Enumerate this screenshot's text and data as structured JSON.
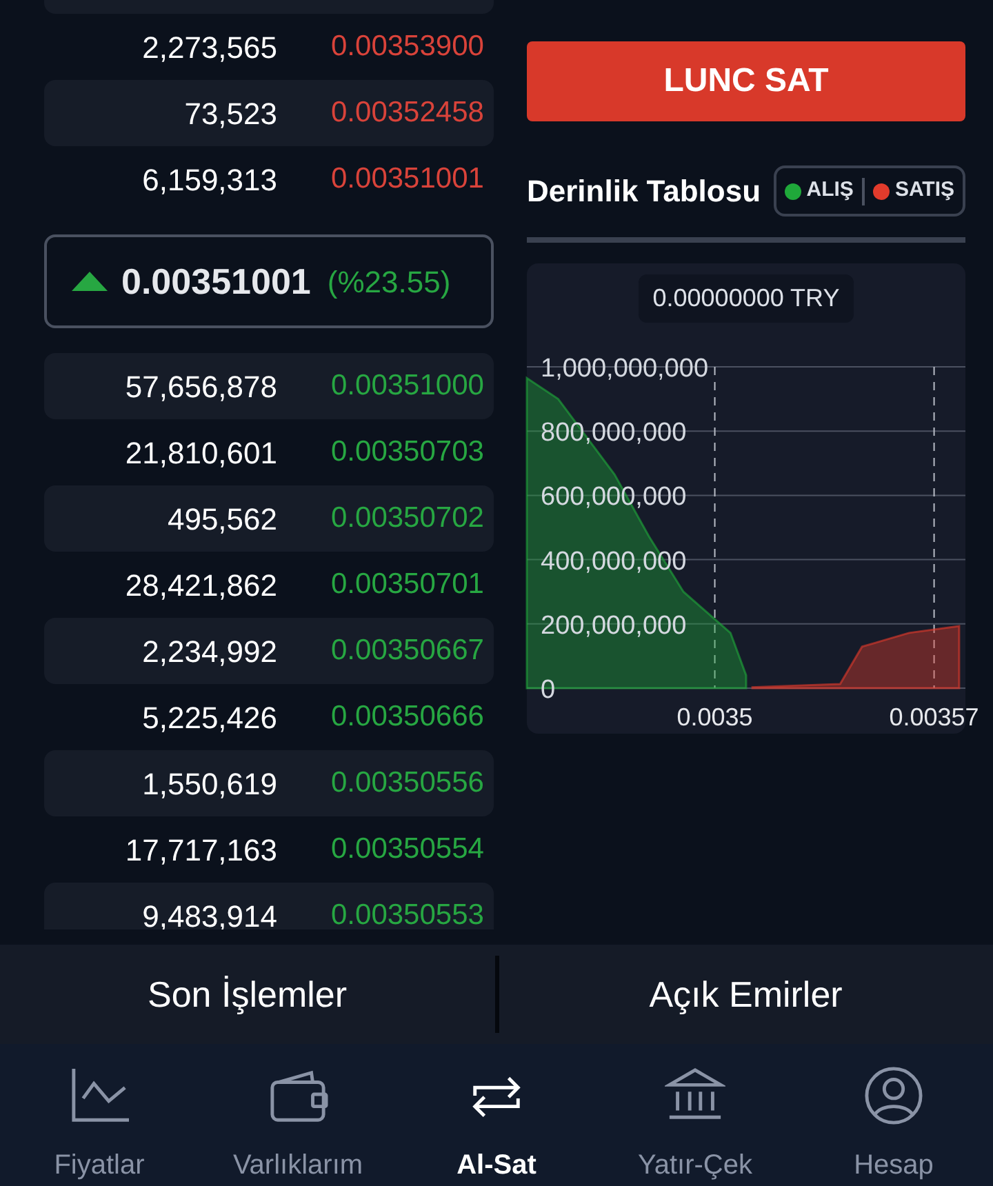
{
  "order_book": {
    "asks": [
      {
        "amount": "2,273,565",
        "price": "0.00353900"
      },
      {
        "amount": "73,523",
        "price": "0.00352458"
      },
      {
        "amount": "6,159,313",
        "price": "0.00351001"
      }
    ],
    "last_price": {
      "rising": true,
      "price": "0.00351001",
      "change": "(%23.55)"
    },
    "bids": [
      {
        "amount": "57,656,878",
        "price": "0.00351000"
      },
      {
        "amount": "21,810,601",
        "price": "0.00350703"
      },
      {
        "amount": "495,562",
        "price": "0.00350702"
      },
      {
        "amount": "28,421,862",
        "price": "0.00350701"
      },
      {
        "amount": "2,234,992",
        "price": "0.00350667"
      },
      {
        "amount": "5,225,426",
        "price": "0.00350666"
      },
      {
        "amount": "1,550,619",
        "price": "0.00350556"
      },
      {
        "amount": "17,717,163",
        "price": "0.00350554"
      },
      {
        "amount": "9,483,914",
        "price": "0.00350553"
      }
    ]
  },
  "sell_button": "LUNC SAT",
  "depth_chart": {
    "title": "Derinlik Tablosu",
    "price_label": "0.00000000 TRY",
    "chart_data": {
      "type": "area",
      "grid": true,
      "x": [
        0.00344,
        0.00345,
        0.003468,
        0.003479,
        0.00349,
        0.003505,
        0.00351,
        0.003512,
        0.00354,
        0.003547,
        0.003562,
        0.003578
      ],
      "series": [
        {
          "name": "ALIŞ",
          "color": "#1fa83a",
          "values": [
            965000000,
            900000000,
            665000000,
            472000000,
            300000000,
            172000000,
            40000000,
            null,
            null,
            null,
            null,
            null
          ]
        },
        {
          "name": "SATIŞ",
          "color": "#e23b2c",
          "values": [
            null,
            null,
            null,
            null,
            null,
            null,
            null,
            3000000,
            13000000,
            129000000,
            172000000,
            193000000
          ]
        }
      ],
      "xlim": [
        0.00344,
        0.00358
      ],
      "ylim": [
        0,
        1321888412
      ],
      "xticks": [
        {
          "value": 0.0035,
          "label": "0.0035"
        },
        {
          "value": 0.00357,
          "label": "0.00357"
        }
      ],
      "yticks": [
        {
          "value": 0,
          "label": "0"
        },
        {
          "value": 200000000,
          "label": "200,000,000"
        },
        {
          "value": 400000000,
          "label": "400,000,000"
        },
        {
          "value": 600000000,
          "label": "600,000,000"
        },
        {
          "value": 800000000,
          "label": "800,000,000"
        },
        {
          "value": 1000000000,
          "label": "1,000,000,000"
        }
      ]
    }
  },
  "bottom_tabs": [
    {
      "label": "Son İşlemler"
    },
    {
      "label": "Açık Emirler"
    }
  ],
  "nav": [
    {
      "kind": "chart",
      "label": "Fiyatlar",
      "selected": false
    },
    {
      "kind": "wallet",
      "label": "Varlıklarım",
      "selected": false
    },
    {
      "kind": "swap",
      "label": "Al-Sat",
      "selected": true
    },
    {
      "kind": "bank",
      "label": "Yatır-Çek",
      "selected": false
    },
    {
      "kind": "account",
      "label": "Hesap",
      "selected": false
    }
  ]
}
